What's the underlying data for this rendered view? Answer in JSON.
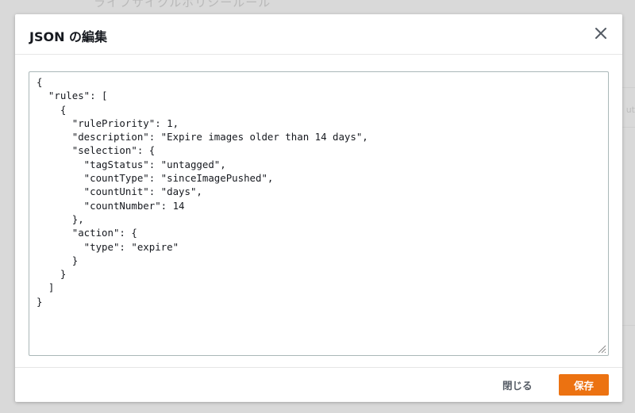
{
  "background": {
    "heading": "ライフサイクルポリシールール",
    "right_text": "ut"
  },
  "modal": {
    "title": "JSON の編集",
    "close_icon": "close-icon",
    "editor": {
      "content": "{\n  \"rules\": [\n    {\n      \"rulePriority\": 1,\n      \"description\": \"Expire images older than 14 days\",\n      \"selection\": {\n        \"tagStatus\": \"untagged\",\n        \"countType\": \"sinceImagePushed\",\n        \"countUnit\": \"days\",\n        \"countNumber\": 14\n      },\n      \"action\": {\n        \"type\": \"expire\"\n      }\n    }\n  ]\n}"
    },
    "footer": {
      "cancel_label": "閉じる",
      "save_label": "保存"
    }
  },
  "colors": {
    "primary_button": "#ec7211",
    "text": "#16191f",
    "secondary_text": "#545b64"
  }
}
